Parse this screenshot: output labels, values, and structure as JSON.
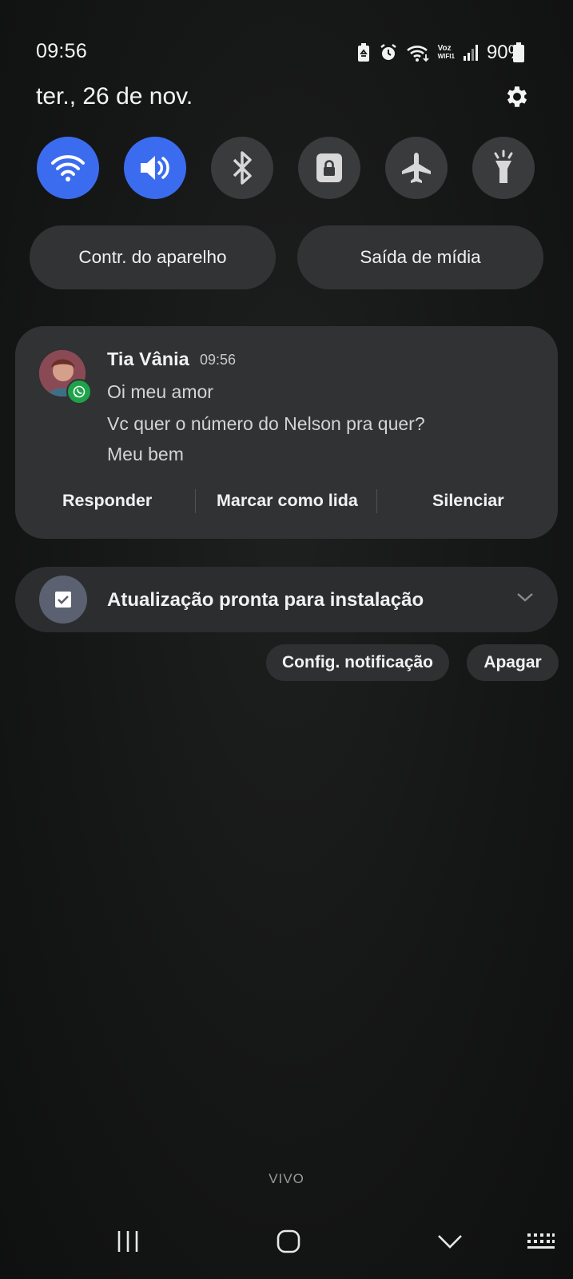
{
  "status_bar": {
    "time": "09:56",
    "battery": "90%",
    "icons": [
      "recycle-battery-icon",
      "alarm-icon",
      "wifi-icon",
      "voz-wifi-icon",
      "signal-icon",
      "battery-icon"
    ],
    "voz_label_top": "Voz",
    "voz_label_bottom": "WIFI1"
  },
  "header": {
    "date": "ter., 26 de nov."
  },
  "quick_toggles": [
    {
      "name": "wifi",
      "icon": "wifi-icon",
      "active": true
    },
    {
      "name": "sound",
      "icon": "volume-icon",
      "active": true
    },
    {
      "name": "bluetooth",
      "icon": "bluetooth-icon",
      "active": false
    },
    {
      "name": "rotation-lock",
      "icon": "lock-icon",
      "active": false
    },
    {
      "name": "airplane",
      "icon": "airplane-icon",
      "active": false
    },
    {
      "name": "flashlight",
      "icon": "flashlight-icon",
      "active": false
    }
  ],
  "pills": {
    "device_control": "Contr. do aparelho",
    "media_output": "Saída de mídia"
  },
  "notification": {
    "sender": "Tia Vânia",
    "time": "09:56",
    "messages": [
      "Oi meu amor",
      "Vc quer o número do Nelson pra quer?",
      "Meu bem"
    ],
    "actions": {
      "reply": "Responder",
      "mark_read": "Marcar como lida",
      "mute": "Silenciar"
    }
  },
  "update": {
    "text": "Atualização pronta para instalação"
  },
  "buttons": {
    "notification_settings": "Config. notificação",
    "clear": "Apagar"
  },
  "carrier": "VIVO",
  "colors": {
    "accent": "#3b6cf0",
    "whatsapp": "#1ea34a",
    "card": "#313233",
    "toggle_off": "#3a3b3c"
  }
}
